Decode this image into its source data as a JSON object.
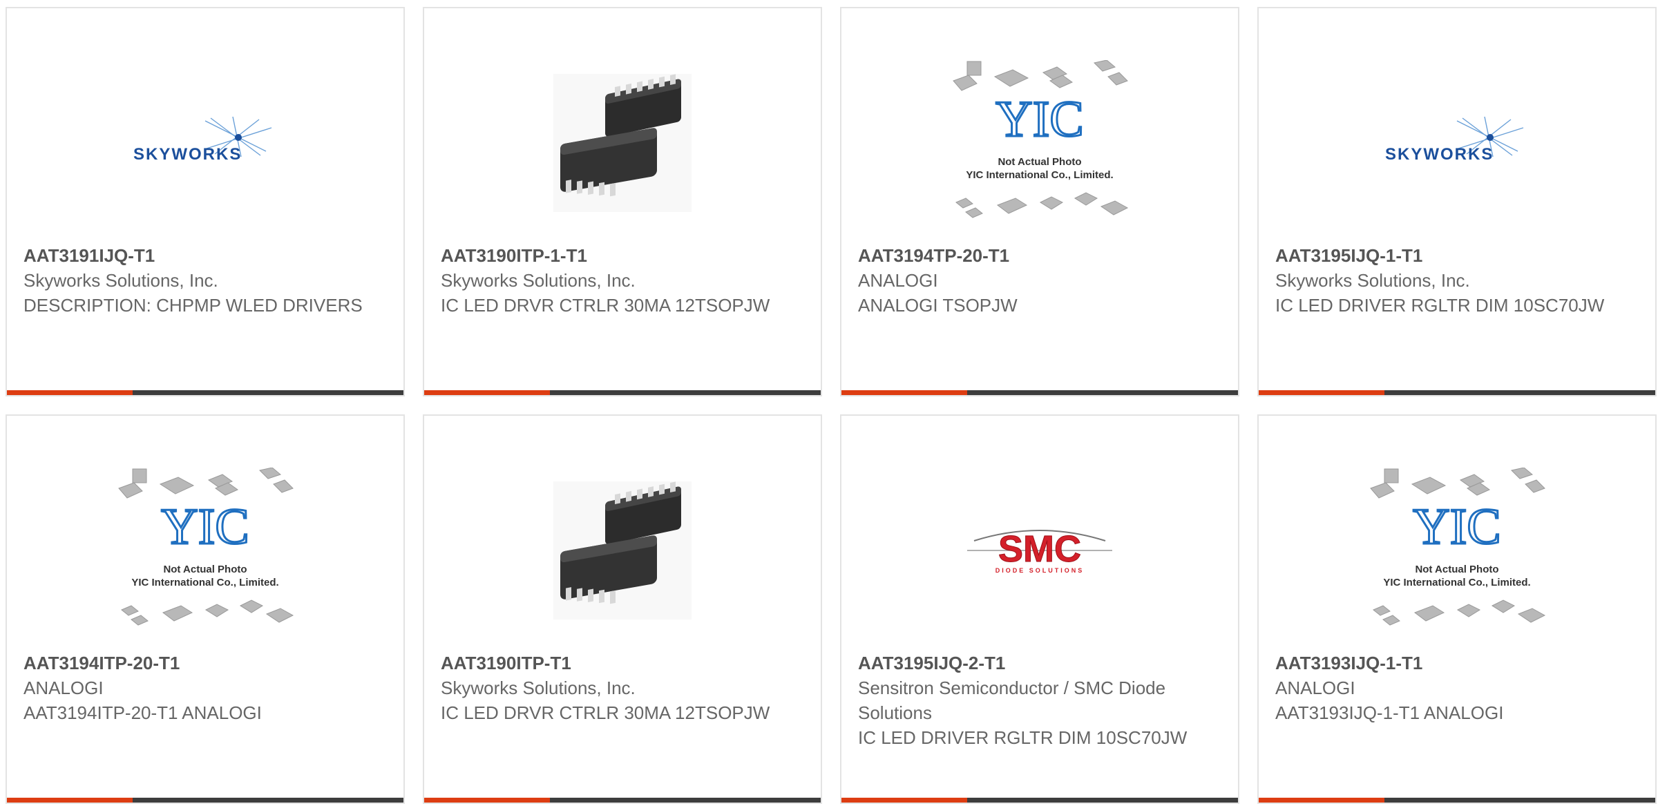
{
  "products": [
    {
      "part_number": "AAT3191IJQ-T1",
      "manufacturer": "Skyworks Solutions, Inc.",
      "description": "DESCRIPTION: CHPMP WLED DRIVERS",
      "image": "skyworks-logo",
      "logo_text": "SKYWORKS"
    },
    {
      "part_number": "AAT3190ITP-1-T1",
      "manufacturer": "Skyworks Solutions, Inc.",
      "description": "IC LED DRVR CTRLR 30MA 12TSOPJW",
      "image": "ic-chip-photo"
    },
    {
      "part_number": "AAT3194TP-20-T1",
      "manufacturer": "ANALOGI",
      "description": "ANALOGI TSOPJW",
      "image": "yic-placeholder",
      "placeholder_line1": "Not Actual Photo",
      "placeholder_line2": "YIC International Co., Limited."
    },
    {
      "part_number": "AAT3195IJQ-1-T1",
      "manufacturer": "Skyworks Solutions, Inc.",
      "description": "IC LED DRIVER RGLTR DIM 10SC70JW",
      "image": "skyworks-logo",
      "logo_text": "SKYWORKS"
    },
    {
      "part_number": "AAT3194ITP-20-T1",
      "manufacturer": "ANALOGI",
      "description": "AAT3194ITP-20-T1 ANALOGI",
      "image": "yic-placeholder",
      "placeholder_line1": "Not Actual Photo",
      "placeholder_line2": "YIC International Co., Limited."
    },
    {
      "part_number": "AAT3190ITP-T1",
      "manufacturer": "Skyworks Solutions, Inc.",
      "description": "IC LED DRVR CTRLR 30MA 12TSOPJW",
      "image": "ic-chip-photo"
    },
    {
      "part_number": "AAT3195IJQ-2-T1",
      "manufacturer": "Sensitron Semiconductor / SMC Diode Solutions",
      "description": "IC LED DRIVER RGLTR DIM 10SC70JW",
      "image": "smc-logo",
      "logo_text": "SMC",
      "logo_subtext": "DIODE SOLUTIONS"
    },
    {
      "part_number": "AAT3193IJQ-1-T1",
      "manufacturer": "ANALOGI",
      "description": "AAT3193IJQ-1-T1 ANALOGI",
      "image": "yic-placeholder",
      "placeholder_line1": "Not Actual Photo",
      "placeholder_line2": "YIC International Co., Limited."
    }
  ],
  "colors": {
    "card_border": "#e3e3e3",
    "bar_dark": "#3d3d3d",
    "bar_accent": "#dd3d12",
    "text": "#666666",
    "skyworks_blue": "#2a5fa8",
    "smc_red": "#d4202a",
    "yic_blue": "#1f6fc0"
  }
}
